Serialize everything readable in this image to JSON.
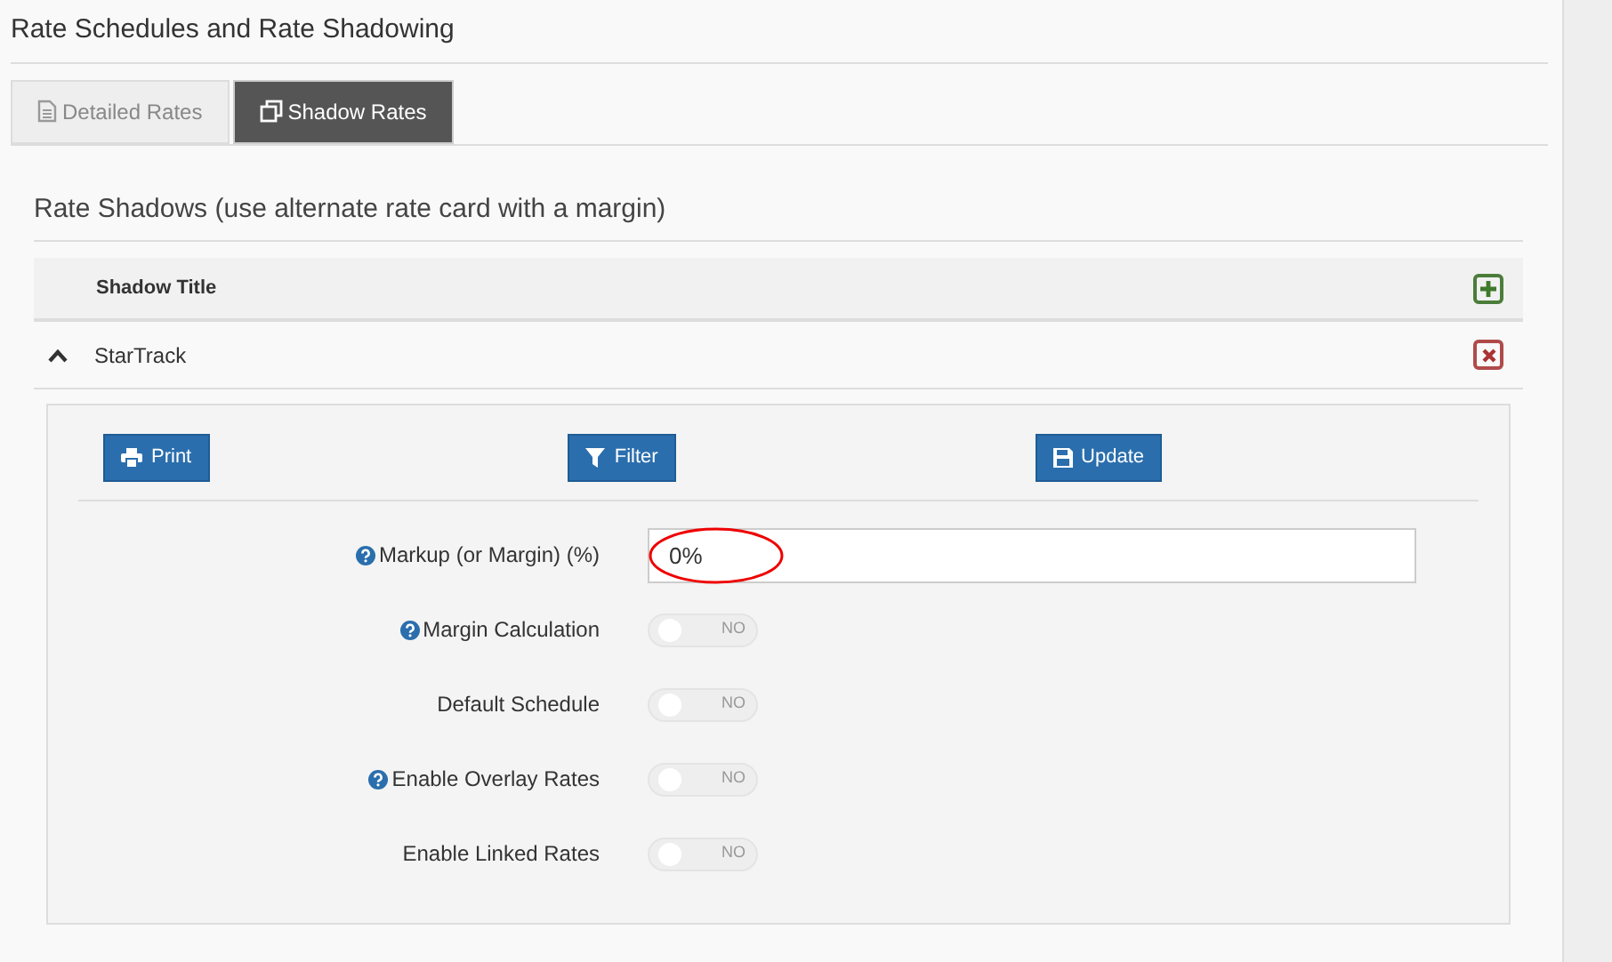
{
  "page_title": "Rate Schedules and Rate Shadowing",
  "tabs": [
    {
      "label": "Detailed Rates",
      "selected": false
    },
    {
      "label": "Shadow Rates",
      "selected": true
    }
  ],
  "section_title": "Rate Shadows (use alternate rate card with a margin)",
  "table": {
    "column": "Shadow Title",
    "rows": [
      {
        "title": "StarTrack",
        "expanded": true
      }
    ]
  },
  "buttons": [
    {
      "label": "Print"
    },
    {
      "label": "Filter"
    },
    {
      "label": "Update"
    }
  ],
  "fields": [
    {
      "kind": "text",
      "label": "Markup (or Margin) (%)",
      "help": true,
      "value": "0%"
    },
    {
      "kind": "toggle",
      "label": "Margin Calculation",
      "help": true,
      "on": false,
      "state_text": "NO"
    },
    {
      "kind": "toggle",
      "label": "Default Schedule",
      "help": false,
      "on": false,
      "state_text": "NO"
    },
    {
      "kind": "toggle",
      "label": "Enable Overlay Rates",
      "help": true,
      "on": false,
      "state_text": "NO"
    },
    {
      "kind": "toggle",
      "label": "Enable Linked Rates",
      "help": false,
      "on": false,
      "state_text": "NO"
    }
  ]
}
